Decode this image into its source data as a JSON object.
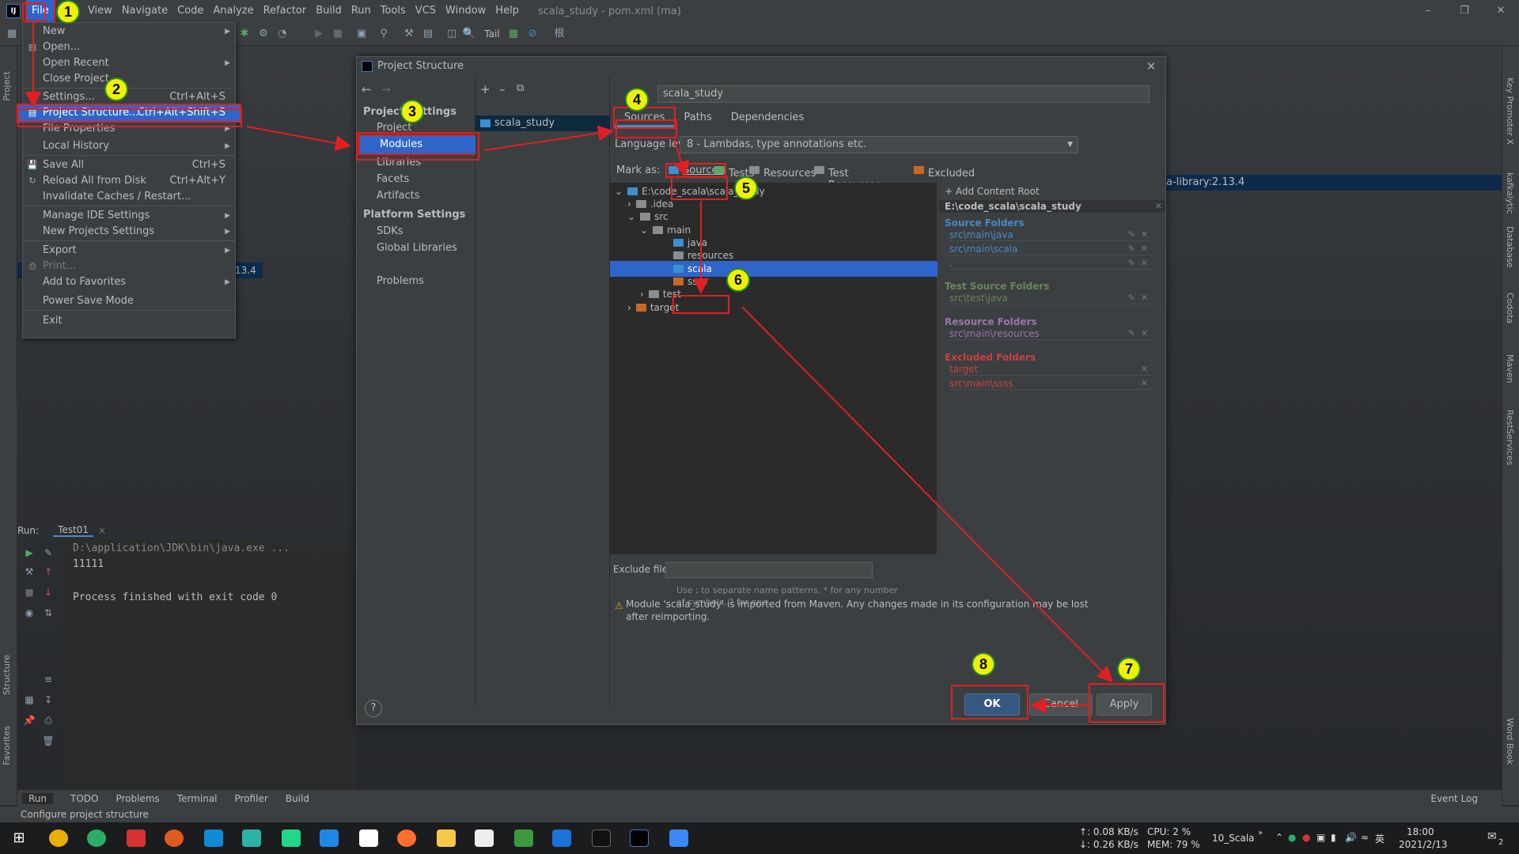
{
  "window": {
    "title": "scala_study - pom.xml (ma)"
  },
  "menubar": [
    "File",
    "Edit",
    "View",
    "Navigate",
    "Code",
    "Analyze",
    "Refactor",
    "Build",
    "Run",
    "Tools",
    "VCS",
    "Window",
    "Help"
  ],
  "toolbar": {
    "tail_label": "Tail"
  },
  "file_menu": {
    "items": [
      {
        "label": "New",
        "shortcut": ""
      },
      {
        "label": "Open...",
        "shortcut": ""
      },
      {
        "label": "Open Recent",
        "shortcut": ""
      },
      {
        "label": "Close Project",
        "shortcut": ""
      },
      {
        "label": "Settings...",
        "shortcut": "Ctrl+Alt+S"
      },
      {
        "label": "Project Structure...",
        "shortcut": "Ctrl+Alt+Shift+S"
      },
      {
        "label": "File Properties",
        "shortcut": ""
      },
      {
        "label": "Local History",
        "shortcut": ""
      },
      {
        "label": "Save All",
        "shortcut": "Ctrl+S"
      },
      {
        "label": "Reload All from Disk",
        "shortcut": "Ctrl+Alt+Y"
      },
      {
        "label": "Invalidate Caches / Restart...",
        "shortcut": ""
      },
      {
        "label": "Manage IDE Settings",
        "shortcut": ""
      },
      {
        "label": "New Projects Settings",
        "shortcut": ""
      },
      {
        "label": "Export",
        "shortcut": ""
      },
      {
        "label": "Print...",
        "shortcut": ""
      },
      {
        "label": "Add to Favorites",
        "shortcut": ""
      },
      {
        "label": "Power Save Mode",
        "shortcut": ""
      },
      {
        "label": "Exit",
        "shortcut": ""
      }
    ]
  },
  "background": {
    "scala_library": "a-library:2.13.4",
    "left_version": "13.4"
  },
  "dialog": {
    "title": "Project Structure",
    "nav": {
      "project_settings": "Project Settings",
      "items": [
        "Project",
        "Modules",
        "Libraries",
        "Facets",
        "Artifacts"
      ],
      "platform_settings": "Platform Settings",
      "platform_items": [
        "SDKs",
        "Global Libraries"
      ],
      "problems": "Problems"
    },
    "module": "scala_study",
    "name_value": "scala_study",
    "tabs": [
      "Sources",
      "Paths",
      "Dependencies"
    ],
    "language_level_label": "Language level:",
    "language_level_value": "8 - Lambdas, type annotations etc.",
    "mark_as_label": "Mark as:",
    "mark_as": [
      "Sources",
      "Tests",
      "Resources",
      "Test Resources",
      "Excluded"
    ],
    "tree": {
      "root": "E:\\code_scala\\scala_study",
      "idea": ".idea",
      "src": "src",
      "main": "main",
      "java": "java",
      "resources": "resources",
      "scala": "scala",
      "ssss": "ssss",
      "test": "test",
      "target": "target"
    },
    "content_root": {
      "add_label": "+ Add Content Root",
      "path": "E:\\code_scala\\scala_study",
      "source_folders_title": "Source Folders",
      "source_folders": [
        "src\\main\\java",
        "src\\main\\scala",
        "."
      ],
      "test_source_title": "Test Source Folders",
      "test_sources": [
        "src\\test\\java"
      ],
      "resource_title": "Resource Folders",
      "resources": [
        "src\\main\\resources"
      ],
      "excluded_title": "Excluded Folders",
      "excluded": [
        "target",
        "src\\main\\ssss"
      ]
    },
    "exclude_files_label": "Exclude files:",
    "exclude_hint": "Use ; to separate name patterns, * for any number of symbols, ? for one.",
    "warning": "Module 'scala_study' is imported from Maven. Any changes made in its configuration may be lost after reimporting.",
    "buttons": {
      "ok": "OK",
      "cancel": "Cancel",
      "apply": "Apply",
      "help": "?"
    }
  },
  "run_panel": {
    "label": "Run:",
    "tab": "Test01",
    "lines": [
      "D:\\application\\JDK\\bin\\java.exe ...",
      "11111",
      "",
      "Process finished with exit code 0"
    ]
  },
  "bottom_tabs": [
    "Run",
    "TODO",
    "Problems",
    "Terminal",
    "Profiler",
    "Build"
  ],
  "event_log": "Event Log",
  "status": "Configure project structure",
  "side_tabs": {
    "left": [
      "Project",
      "Structure",
      "Favorites"
    ],
    "right": [
      "Key Promoter X",
      "kafkalytic",
      "Database",
      "Codota",
      "Maven",
      "RestServices",
      "Word Book"
    ]
  },
  "taskbar": {
    "net_up": "↑: 0.08 KB/s",
    "net_down": "↓: 0.26 KB/s",
    "cpu": "CPU:  2 %",
    "mem": "MEM: 79 %",
    "user": "10_Scala",
    "ime": "英",
    "time": "18:00",
    "date": "2021/2/13",
    "notif": "2"
  },
  "annotations": [
    "1",
    "2",
    "3",
    "4",
    "5",
    "6",
    "7",
    "8"
  ],
  "colors": {
    "selection": "#2f65ca",
    "annotation_red": "#e02020",
    "badge_yellow": "#eef200",
    "source_blue": "#4a88c7",
    "test_green": "#6a8759",
    "resource_purple": "#9876aa",
    "excluded_red": "#cc4040"
  }
}
